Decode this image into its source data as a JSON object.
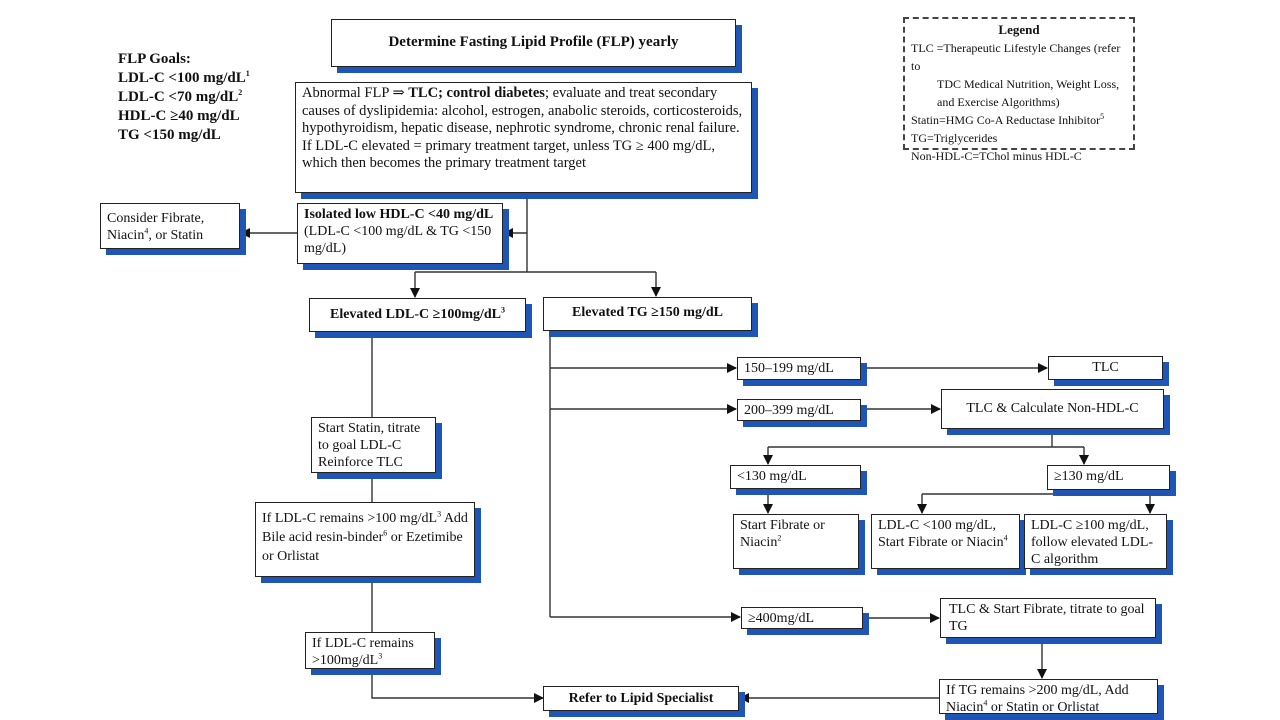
{
  "goals": {
    "title": "FLP Goals:",
    "items": [
      "LDL-C <100 mg/dL",
      "LDL-C <70 mg/dL",
      "HDL-C ≥40 mg/dL",
      "TG <150 mg/dL"
    ],
    "sups": [
      "1",
      "2",
      "",
      ""
    ]
  },
  "legend": {
    "title": "Legend",
    "tlc_1": "TLC =Therapeutic Lifestyle Changes (refer to",
    "tlc_2": "TDC Medical Nutrition, Weight Loss,",
    "tlc_3": "and Exercise Algorithms)",
    "statin": "Statin=HMG Co-A Reductase Inhibitor",
    "statin_sup": "5",
    "tg": "TG=Triglycerides",
    "nonhdl": "Non-HDL-C=TChol minus HDL-C"
  },
  "nodes": {
    "title": "Determine Fasting Lipid Profile (FLP) yearly",
    "abnormal": {
      "a": "Abnormal FLP ⇒ ",
      "b": "TLC; control diabetes",
      "c": "; evaluate and treat secondary causes of dyslipidemia: alcohol, estrogen, anabolic steroids, corticosteroids, hypothyroidism, hepatic disease, nephrotic syndrome, chronic renal failure.",
      "d": "If LDL-C elevated = primary treatment  target, unless TG ≥ 400 mg/dL, which then becomes the primary treatment target"
    },
    "isolated": {
      "a": "Isolated low HDL-C <40 mg/dL",
      "b": "(LDL-C <100 mg/dL & TG <150 mg/dL)"
    },
    "consider": {
      "a": "Consider Fibrate, Niacin",
      "sup": "4",
      "b": ", or Statin"
    },
    "elev_ldl": {
      "a": "Elevated LDL-C ≥100mg/dL",
      "sup": "3"
    },
    "elev_tg": "Elevated TG ≥150 mg/dL",
    "start_statin": "Start Statin, titrate to goal LDL-C Reinforce TLC",
    "if_ldl_1": {
      "a": "If LDL-C remains >100 mg/dL",
      "sup": "3",
      "b": " Add Bile acid resin-binder",
      "sup2": "6",
      "c": " or Ezetimibe or Orlistat"
    },
    "if_ldl_2": {
      "a": "If LDL-C remains >100mg/dL",
      "sup": "3"
    },
    "refer": "Refer to Lipid Specialist",
    "r150": "150–199 mg/dL",
    "tlc": "TLC",
    "r200": "200–399 mg/dL",
    "tlc_nonhdl": "TLC & Calculate Non-HDL-C",
    "lt130": "<130 mg/dL",
    "ge130": "≥130 mg/dL",
    "fibrate": {
      "a": "Start Fibrate or Niacin",
      "sup": "2"
    },
    "ldl_lt": {
      "a": "LDL-C <100 mg/dL, Start Fibrate or Niacin",
      "sup": "4"
    },
    "ldl_ge": "LDL-C ≥100 mg/dL, follow elevated LDL-C algorithm",
    "ge400": "≥400mg/dL",
    "tlc_fibrate": "TLC & Start Fibrate, titrate to goal TG",
    "if_tg": {
      "a": "If  TG remains >200 mg/dL, Add Niacin",
      "sup": "4",
      "b": " or Statin or Orlistat"
    }
  },
  "colors": {
    "shadow": "#1f55b5",
    "line": "#222222"
  }
}
